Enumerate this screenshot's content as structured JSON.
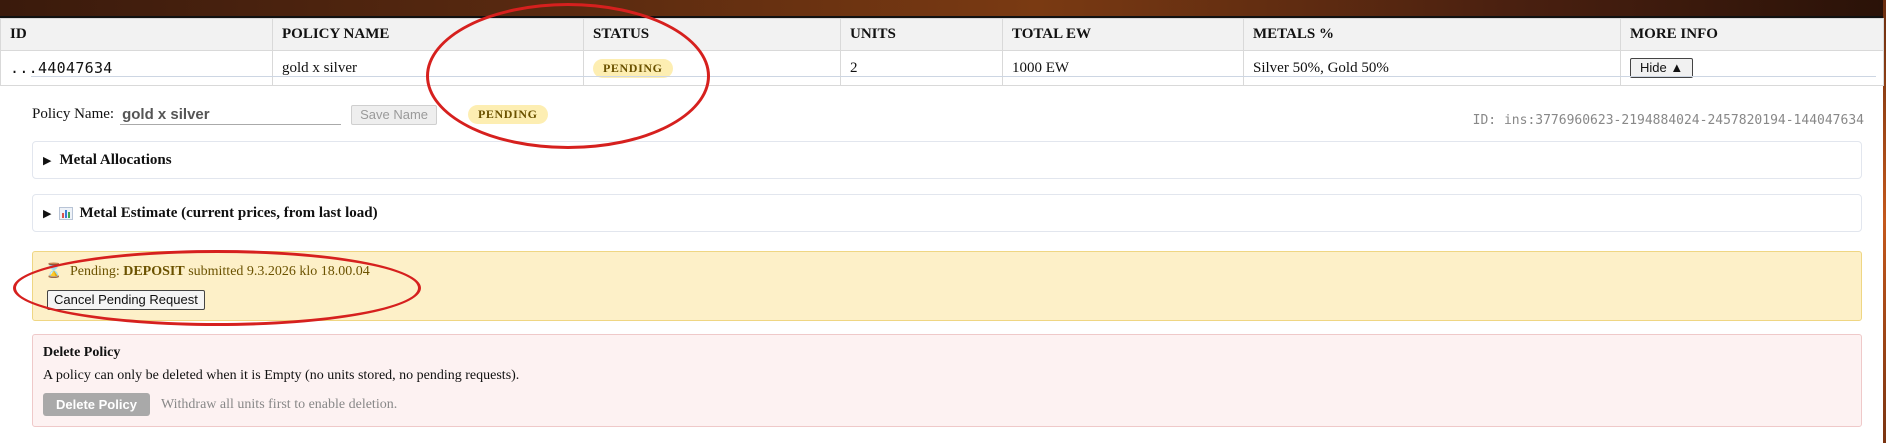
{
  "table": {
    "headers": [
      "ID",
      "POLICY NAME",
      "STATUS",
      "UNITS",
      "TOTAL EW",
      "METALS %",
      "MORE INFO"
    ],
    "row": {
      "id": "...44047634",
      "policy_name": "gold x silver",
      "status": "PENDING",
      "units": "2",
      "total_ew": "1000 EW",
      "metals": "Silver 50%, Gold 50%",
      "more_info_button": "Hide ▲"
    }
  },
  "details": {
    "name_label": "Policy Name:",
    "name_value": "gold x silver",
    "save_button": "Save Name",
    "status_badge": "PENDING",
    "id_text": "ID: ins:3776960623-2194884024-2457820194-144047634"
  },
  "sections": {
    "metal_allocations": "Metal Allocations",
    "metal_estimate": "Metal Estimate (current prices, from last load)"
  },
  "pending": {
    "prefix": "Pending:",
    "type": "DEPOSIT",
    "suffix": "submitted 9.3.2026 klo 18.00.04",
    "cancel_button": "Cancel Pending Request"
  },
  "delete": {
    "title": "Delete Policy",
    "description": "A policy can only be deleted when it is Empty (no units stored, no pending requests).",
    "button": "Delete Policy",
    "hint": "Withdraw all units first to enable deletion."
  },
  "icons": {
    "hourglass": "hourglass-icon",
    "chart": "bar-chart-icon",
    "expand": "triangle-right-icon"
  },
  "colors": {
    "pending_badge_bg": "#fdeeb2",
    "pending_box_bg": "#fdf0c8",
    "delete_box_bg": "#fdf2f2",
    "annotation": "#d6201e"
  }
}
